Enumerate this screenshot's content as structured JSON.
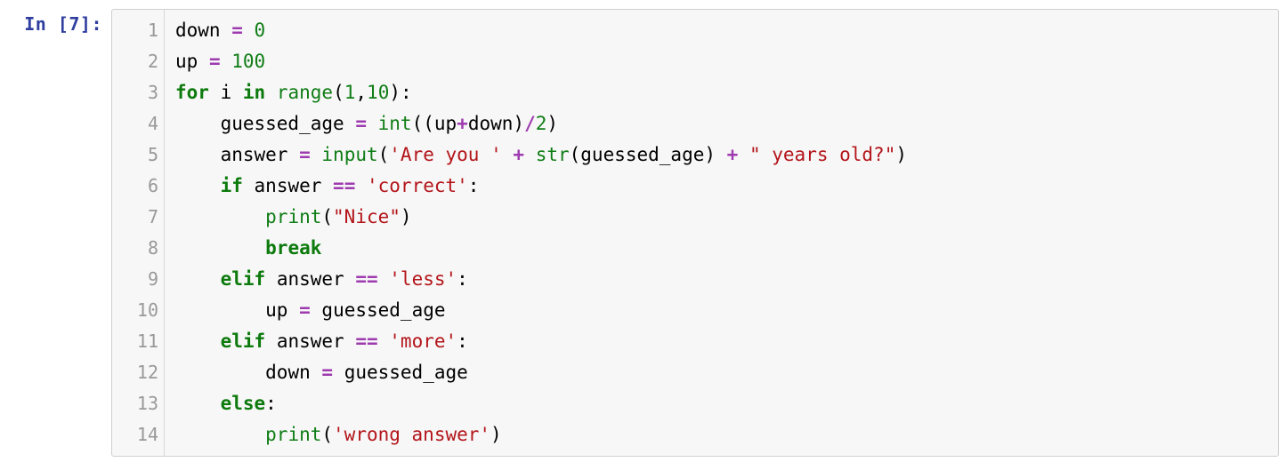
{
  "prompt": {
    "text": "In [7]:"
  },
  "gutter": [
    "1",
    "2",
    "3",
    "4",
    "5",
    "6",
    "7",
    "8",
    "9",
    "10",
    "11",
    "12",
    "13",
    "14"
  ],
  "tokens": {
    "name_down": "down",
    "name_up": "up",
    "name_i": "i",
    "name_range": "range",
    "name_guessed_age": "guessed_age",
    "name_int": "int",
    "name_answer": "answer",
    "name_input": "input",
    "name_str": "str",
    "name_print": "print",
    "op_assign": "=",
    "op_plus": "+",
    "op_div": "/",
    "op_eq": "==",
    "num_0": "0",
    "num_100": "100",
    "num_1": "1",
    "num_10": "10",
    "num_2": "2",
    "kw_for": "for",
    "kw_in": "in",
    "kw_if": "if",
    "kw_elif": "elif",
    "kw_else": "else",
    "kw_break": "break",
    "str_areyou": "'Are you '",
    "str_years": "\" years old?\"",
    "str_correct": "'correct'",
    "str_nice": "\"Nice\"",
    "str_less": "'less'",
    "str_more": "'more'",
    "str_wrong": "'wrong answer'",
    "punc_lparen": "(",
    "punc_rparen": ")",
    "punc_comma": ",",
    "punc_colon": ":"
  }
}
